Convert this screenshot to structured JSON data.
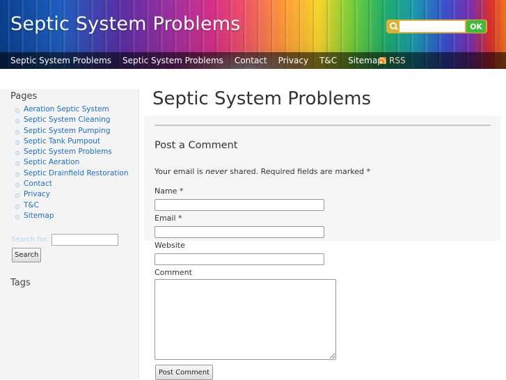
{
  "header": {
    "site_title": "Septic System Problems",
    "search_icon": "search-icon",
    "search_value": "",
    "ok_label": "OK"
  },
  "nav": {
    "items": [
      "Septic System Problems",
      "Septic System Problems",
      "Contact",
      "Privacy",
      "T&C",
      "Sitemap"
    ],
    "rss_label": "RSS",
    "rss_icon": "rss-icon"
  },
  "sidebar": {
    "pages_heading": "Pages",
    "pages": [
      "Aeration Septic System",
      "Septic System Cleaning",
      "Septic System Pumping",
      "Septic Tank Pumpout",
      "Septic System Problems",
      "Septic Aeration",
      "Septic Drainfield Restoration",
      "Contact",
      "Privacy",
      "T&C",
      "Sitemap"
    ],
    "search_label": "Search for:",
    "search_value": "",
    "search_button": "Search",
    "tags_heading": "Tags"
  },
  "main": {
    "title": "Septic System Problems",
    "comment_heading": "Post a Comment",
    "note_before": "Your email is ",
    "note_emphasis": "never",
    "note_after": " shared. Required fields are marked *",
    "name_label": "Name *",
    "email_label": "Email *",
    "website_label": "Website",
    "comment_label": "Comment",
    "post_button": "Post Comment"
  },
  "colors": {
    "link": "#1a6fc4",
    "ok_button": "#3fba3a",
    "nav_bg": "rgba(0,0,0,0.55)"
  }
}
